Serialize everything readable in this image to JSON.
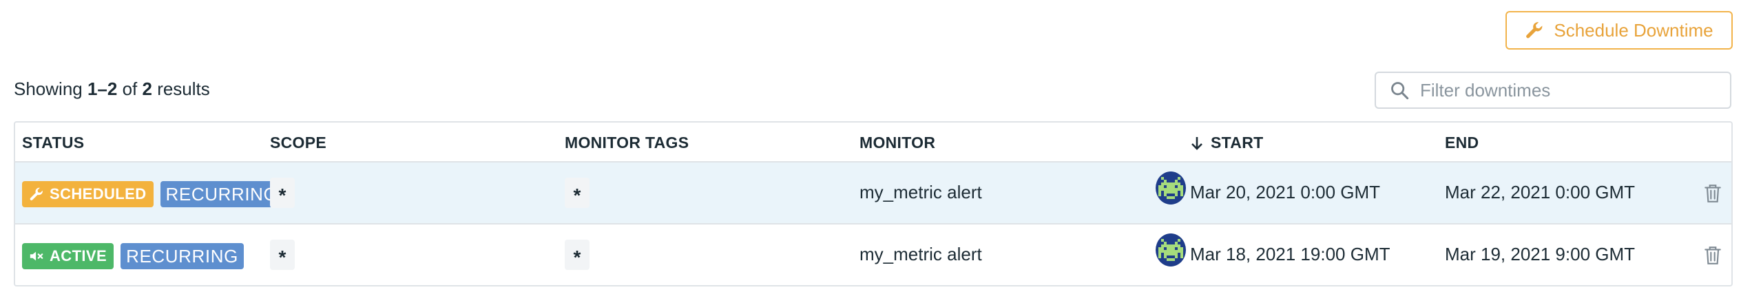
{
  "toolbar": {
    "schedule_button": "Schedule Downtime",
    "schedule_icon": "wrench-icon"
  },
  "summary": {
    "prefix": "Showing ",
    "range": "1–2",
    "of": " of ",
    "total": "2",
    "suffix": " results"
  },
  "filter": {
    "placeholder": "Filter downtimes",
    "value": "",
    "icon": "search-icon"
  },
  "table": {
    "columns": {
      "status": "STATUS",
      "scope": "SCOPE",
      "monitor_tags": "MONITOR TAGS",
      "monitor": "MONITOR",
      "start": "START",
      "end": "END"
    },
    "sort": {
      "column": "start",
      "direction": "descending",
      "icon": "arrow-down-icon"
    },
    "rows": [
      {
        "status": "SCHEDULED",
        "status_icon": "wrench-icon",
        "type": "RECURRING",
        "scope": "*",
        "monitor_tags": "*",
        "monitor": "my_metric alert",
        "start": "Mar 20, 2021 0:00 GMT",
        "end": "Mar 22, 2021 0:00 GMT",
        "selected": true
      },
      {
        "status": "ACTIVE",
        "status_icon": "mute-icon",
        "type": "RECURRING",
        "scope": "*",
        "monitor_tags": "*",
        "monitor": "my_metric alert",
        "start": "Mar 18, 2021 19:00 GMT",
        "end": "Mar 19, 2021 9:00 GMT",
        "selected": false
      }
    ]
  },
  "colors": {
    "accent": "#e8a33a",
    "scheduled": "#f3b23d",
    "active": "#4db868",
    "recurring": "#5e8fcf",
    "selected_row": "#eaf4fa"
  }
}
